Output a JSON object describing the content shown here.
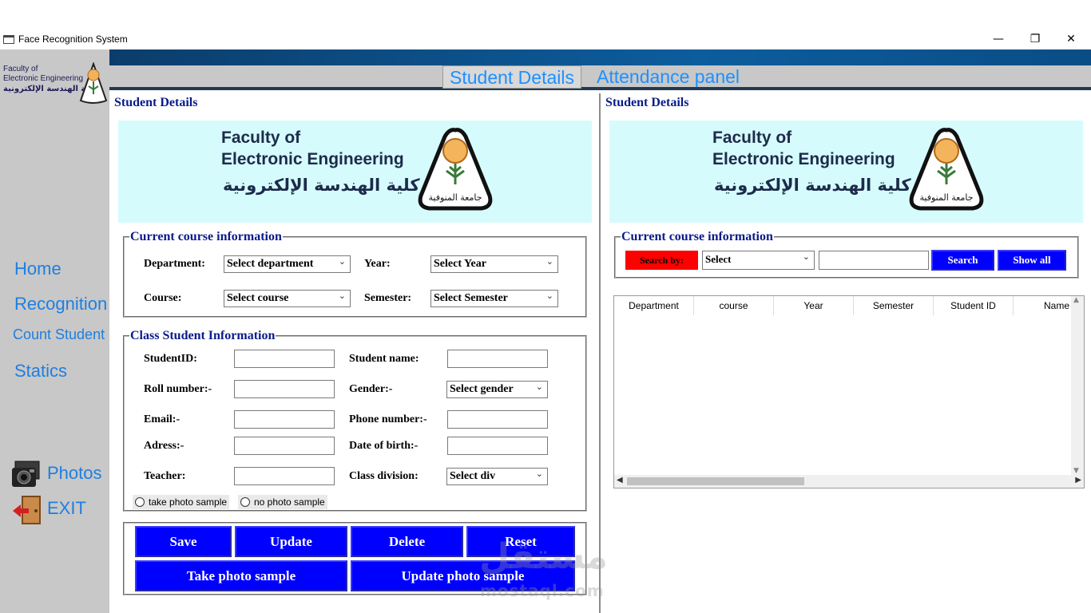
{
  "window": {
    "title": "Face Recognition System",
    "minimize": "—",
    "restore": "❐",
    "close": "✕"
  },
  "sidebar": {
    "logo": {
      "line1": "Faculty of",
      "line2": "Electronic Engineering",
      "line3": "كلية الهندسة الإلكترونية"
    },
    "items": [
      {
        "label": "Home"
      },
      {
        "label": "Recognition"
      },
      {
        "label": "Count Student"
      },
      {
        "label": "Statics"
      },
      {
        "label": "Photos",
        "icon": "photos-icon"
      },
      {
        "label": "EXIT",
        "icon": "exit-door-icon"
      }
    ]
  },
  "tabs": [
    {
      "label": "Student Details",
      "active": true
    },
    {
      "label": "Attendance panel",
      "active": false
    }
  ],
  "left": {
    "title": "Student Details",
    "logo": {
      "line1": "Faculty of",
      "line2": "Electronic Engineering",
      "line3": "كلية الهندسة الإلكترونية",
      "seal_text": "جامعة المنوفية"
    },
    "course": {
      "legend": "Current course information",
      "department_label": "Department:",
      "department_value": "Select department",
      "year_label": "Year:",
      "year_value": "Select Year",
      "course_label": "Course:",
      "course_value": "Select course",
      "semester_label": "Semester:",
      "semester_value": "Select Semester"
    },
    "student": {
      "legend": "Class Student Information",
      "studentid_label": "StudentID:",
      "name_label": "Student name:",
      "roll_label": "Roll number:-",
      "gender_label": "Gender:-",
      "gender_value": "Select gender",
      "email_label": "Email:-",
      "phone_label": "Phone number:-",
      "address_label": "Adress:-",
      "dob_label": "Date of birth:-",
      "teacher_label": "Teacher:",
      "division_label": "Class division:",
      "division_value": "Select div",
      "radio_take": "take photo sample",
      "radio_no": "no photo sample"
    },
    "buttons": {
      "save": "Save",
      "update": "Update",
      "delete": "Delete",
      "reset": "Reset",
      "take_photo": "Take photo sample",
      "update_photo": "Update photo sample"
    }
  },
  "right": {
    "title": "Student Details",
    "logo": {
      "line1": "Faculty of",
      "line2": "Electronic Engineering",
      "line3": "كلية الهندسة الإلكترونية",
      "seal_text": "جامعة المنوفية"
    },
    "search": {
      "legend": "Current course information",
      "search_by": "Search by:",
      "select_value": "Select",
      "search_button": "Search",
      "show_all_button": "Show all"
    },
    "table": {
      "columns": [
        "Department",
        "course",
        "Year",
        "Semester",
        "Student ID",
        "Name"
      ]
    }
  },
  "watermark": {
    "arabic": "مستقل",
    "latin": "mostaql.com"
  },
  "colors": {
    "accent_blue": "#0000ff",
    "nav_blue": "#1e7fe0",
    "search_red": "#ff0000",
    "logo_bg": "#d6fbfd",
    "sidebar_bg": "#c8c8c8"
  }
}
